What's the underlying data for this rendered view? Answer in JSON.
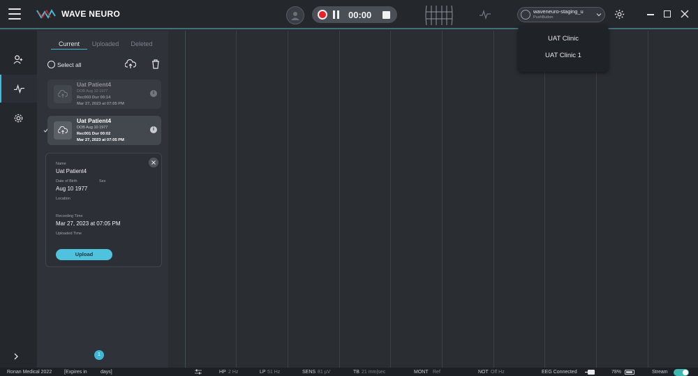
{
  "app": {
    "brand": "WAVE NEURO",
    "brand_colors": {
      "accent": "#46b9d3",
      "record": "#e8212b",
      "upload": "#4fc2dd"
    }
  },
  "toolbar": {
    "timer": "00:00",
    "account_name": "waveneuro-staging_u",
    "account_sub": "PushButton"
  },
  "clinic_menu": {
    "items": [
      "UAT Clinic",
      "UAT Clinic 1"
    ]
  },
  "sidebar": {
    "tabs": [
      "Current",
      "Uploaded",
      "Deleted"
    ],
    "active_tab": "Current",
    "select_all": "Select all",
    "recordings": [
      {
        "name": "Uat Patient4",
        "dob": "DOB Aug 10 1977",
        "rec": "Rec003 Dur 00:14",
        "date": "Mar 27, 2023 at 07:05 PM",
        "state": "dim"
      },
      {
        "name": "Uat Patient4",
        "dob": "DOB Aug 10 1977",
        "rec": "Rec001 Dur 00:02",
        "date": "Mar 27, 2023 at 07:05 PM",
        "state": "selected"
      }
    ],
    "info_glyph": "i"
  },
  "detail": {
    "name_label": "Name",
    "name_value": "Uat Patient4",
    "dob_label": "Date of Birth",
    "dob_value": "Aug 10 1977",
    "sex_label": "Sex",
    "location_label": "Location",
    "rec_time_label": "Recording Time",
    "rec_time_value": "Mar 27, 2023 at 07:05 PM",
    "uploaded_label": "Uploaded Time",
    "upload_button": "Upload"
  },
  "notification_count": "1",
  "status": {
    "license": "Ronan Medical 2022",
    "expires": "[Expires in",
    "days": "days]",
    "hp_label": "HP",
    "hp_value": "2 Hz",
    "lp_label": "LP",
    "lp_value": "51 Hz",
    "sens_label": "SENS",
    "sens_value": "81 µV",
    "tb_label": "TB",
    "tb_value": "21 mm|sec",
    "mont_label": "MONT",
    "mont_value": "Ref",
    "notch_label": "NOT",
    "notch_value": "Off Hz",
    "eeg": "EEG Connected",
    "battery": "78%",
    "stream": "Stream"
  }
}
